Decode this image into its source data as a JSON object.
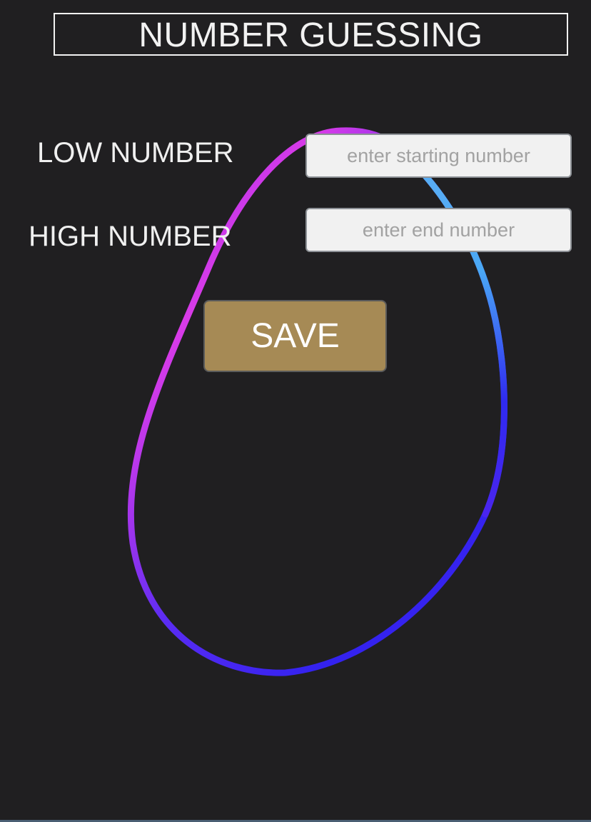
{
  "app": {
    "title": "NUMBER GUESSING"
  },
  "form": {
    "low_label": "LOW NUMBER",
    "low_placeholder": "enter starting number",
    "low_value": "",
    "high_label": "HIGH NUMBER",
    "high_placeholder": "enter end number",
    "high_value": "",
    "save_label": "SAVE"
  },
  "colors": {
    "background": "#201f21",
    "button": "#a68a55",
    "ring_magenta": "#d93be8",
    "ring_blue": "#3322ef",
    "ring_light_blue": "#4aa8f5"
  }
}
